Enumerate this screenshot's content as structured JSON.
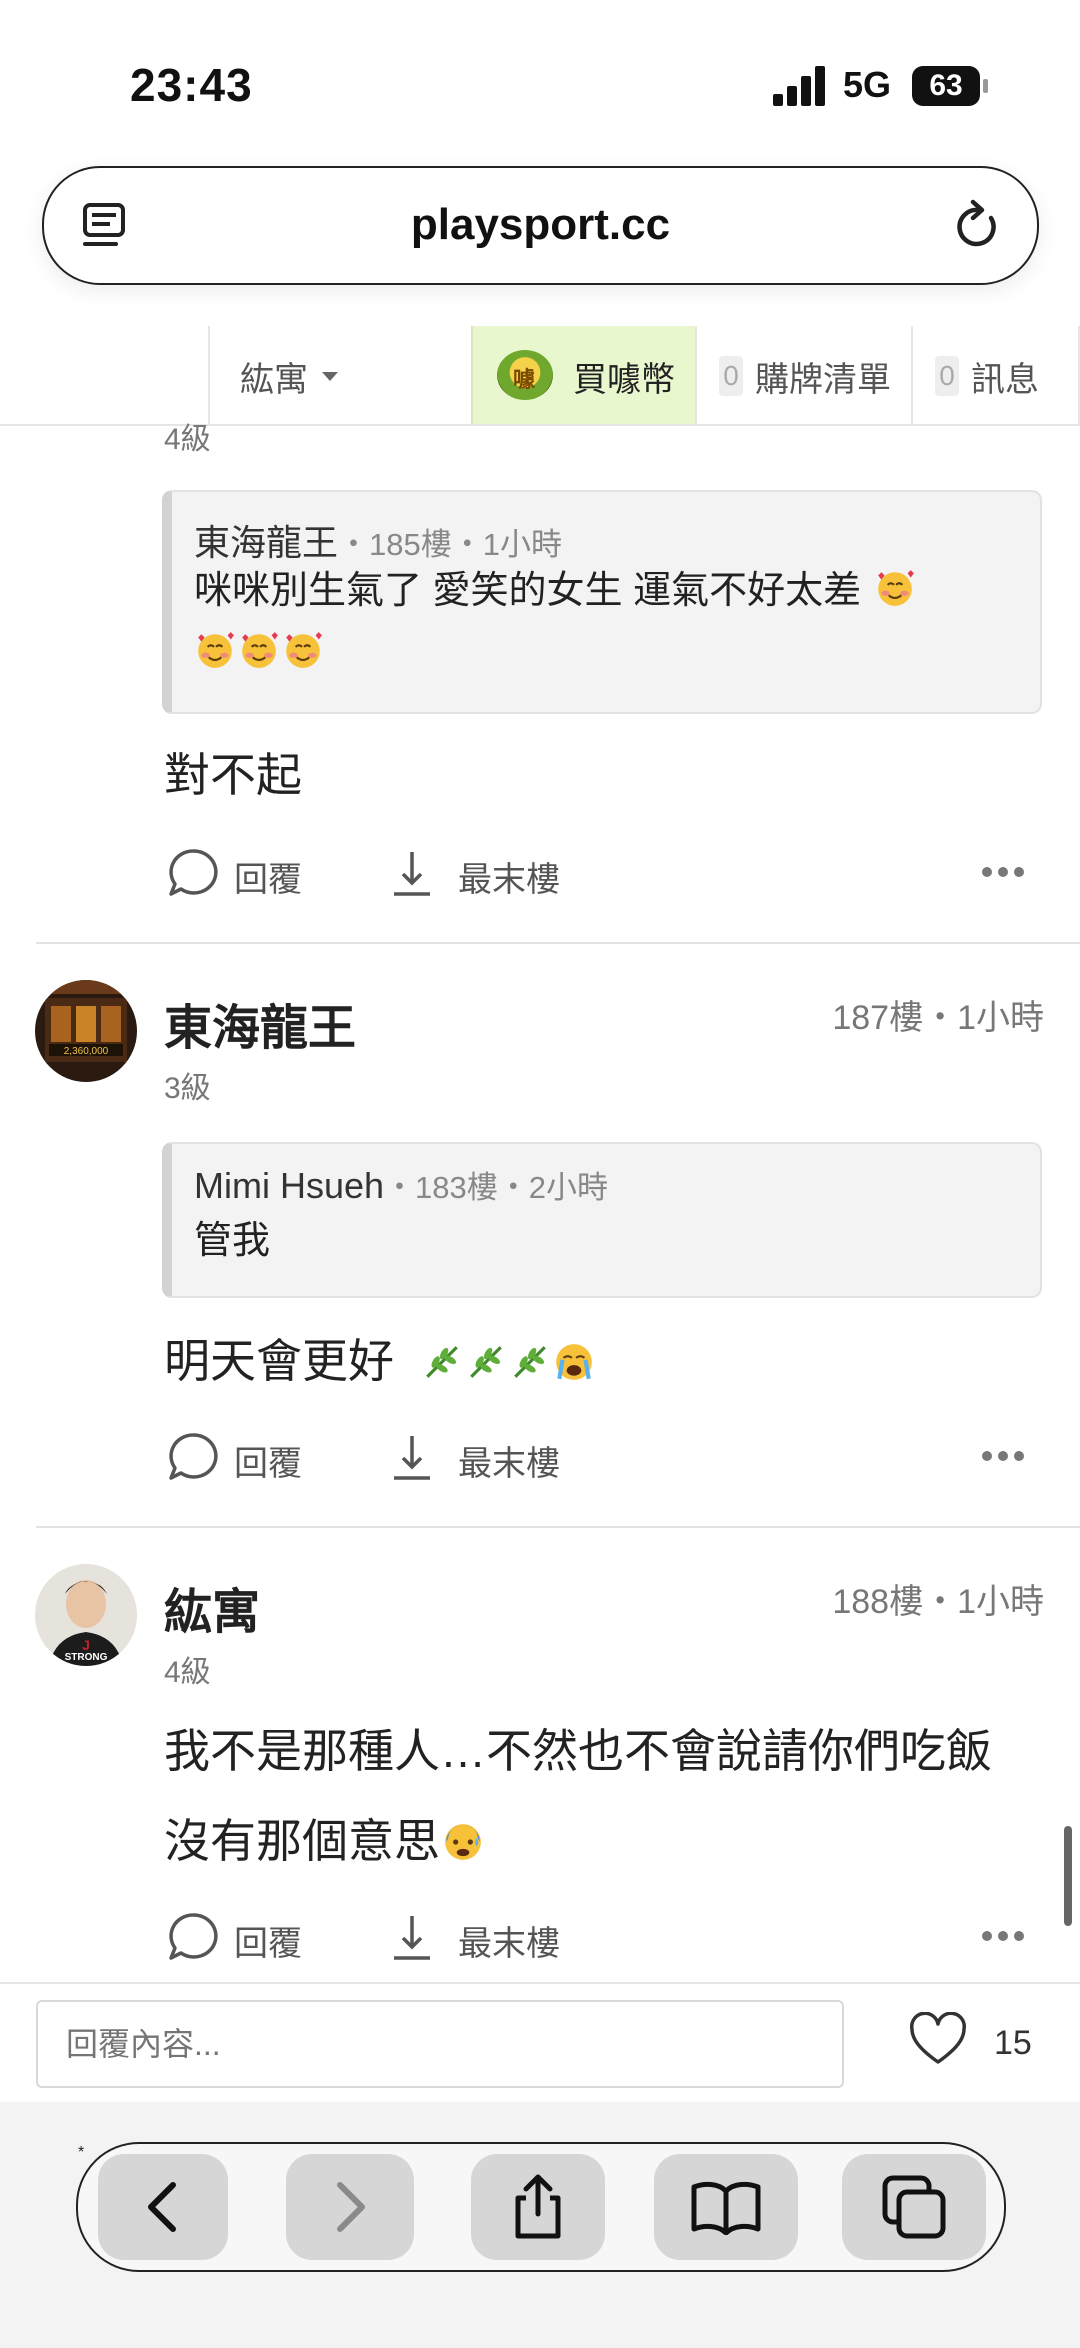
{
  "status_bar": {
    "time": "23:43",
    "network": "5G",
    "battery": "63"
  },
  "browser": {
    "url": "playsport.cc"
  },
  "site_nav": {
    "user_menu": "紘寓",
    "coin_label": "買噱幣",
    "coin_icon_char": "噱",
    "shopping_count": "0",
    "shopping_label": "購牌清單",
    "message_count": "0",
    "message_label": "訊息"
  },
  "comments": [
    {
      "level": "4級",
      "quote": {
        "author": "東海龍王",
        "meta": "・185樓・1小時",
        "text": "咪咪別生氣了  愛笑的女生 運氣不好太差"
      },
      "text": "對不起",
      "reply_label": "回覆",
      "last_floor_label": "最末樓"
    },
    {
      "author": "東海龍王",
      "floor": "187樓・1小時",
      "level": "3級",
      "quote": {
        "author": "Mimi Hsueh",
        "meta": "・183樓・2小時",
        "text": "管我"
      },
      "text": "明天會更好",
      "reply_label": "回覆",
      "last_floor_label": "最末樓"
    },
    {
      "author": "紘寓",
      "floor": "188樓・1小時",
      "level": "4級",
      "avatar_caption": "STRONG",
      "text_line1": "我不是那種人…不然也不會說請你們吃飯",
      "text_line2": "沒有那個意思",
      "reply_label": "回覆",
      "last_floor_label": "最末樓"
    }
  ],
  "reply_bar": {
    "placeholder": "回覆內容...",
    "like_count": "15"
  }
}
